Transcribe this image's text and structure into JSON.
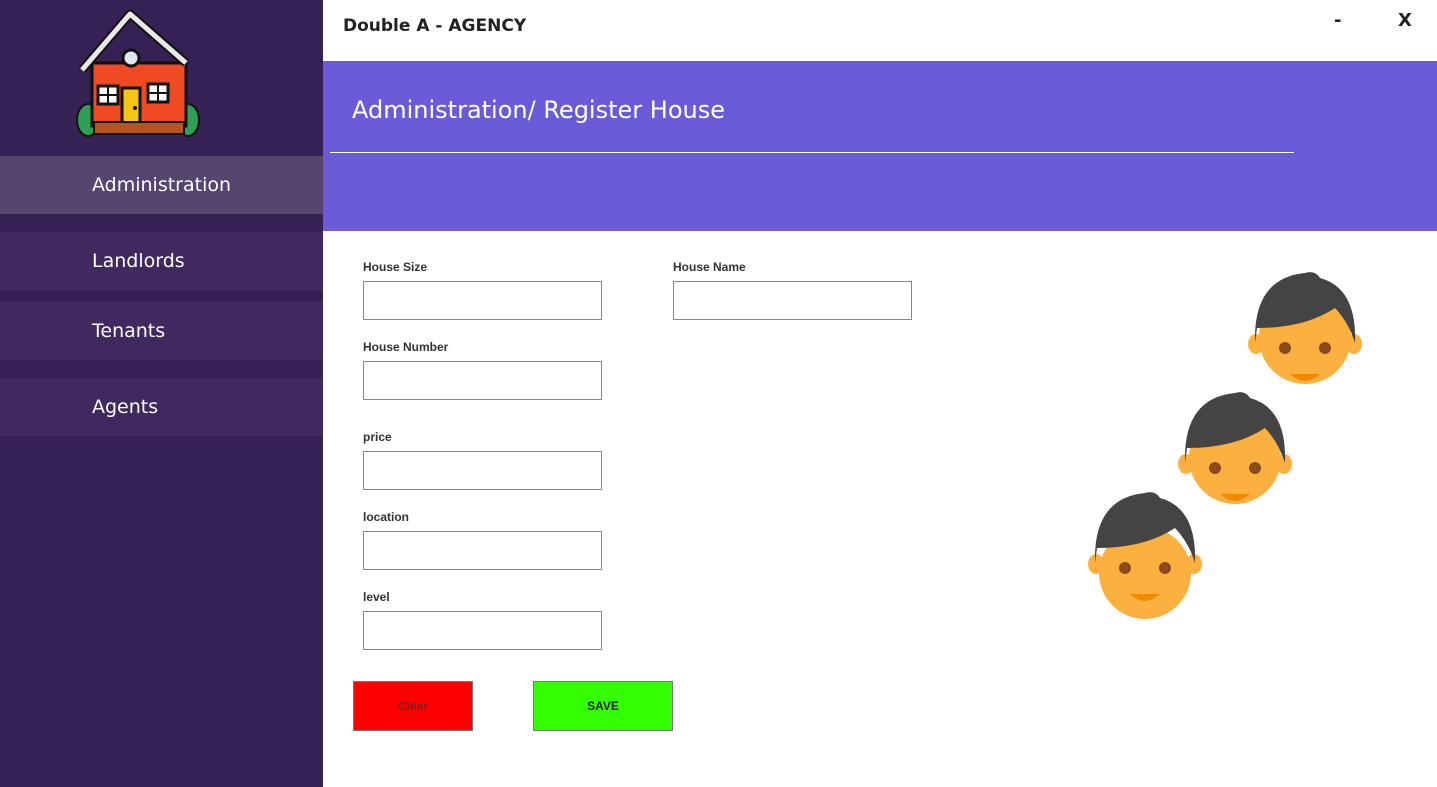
{
  "app": {
    "title": "Double A - AGENCY",
    "minimize_label": "-",
    "close_label": "X"
  },
  "sidebar": {
    "logo_icon": "house-icon",
    "items": [
      {
        "label": "Administration",
        "active": true
      },
      {
        "label": "Landlords",
        "active": false
      },
      {
        "label": "Tenants",
        "active": false
      },
      {
        "label": "Agents",
        "active": false
      }
    ]
  },
  "header": {
    "title": "Administration/ Register House"
  },
  "form": {
    "fields": [
      {
        "label": "House Size",
        "value": ""
      },
      {
        "label": "House Name",
        "value": ""
      },
      {
        "label": "House Number",
        "value": ""
      },
      {
        "label": "price",
        "value": ""
      },
      {
        "label": "location",
        "value": ""
      },
      {
        "label": "level",
        "value": ""
      }
    ],
    "clear_label": "Clear",
    "save_label": "SAVE"
  },
  "illustration": {
    "icon": "people-faces-icon"
  },
  "colors": {
    "sidebar_bg": "#362155",
    "nav_item_bg": "#40295f",
    "nav_active_bg": "#56456f",
    "header_bg": "#6c5bd9",
    "clear_button": "#ff0000",
    "save_button": "#33ff00"
  }
}
